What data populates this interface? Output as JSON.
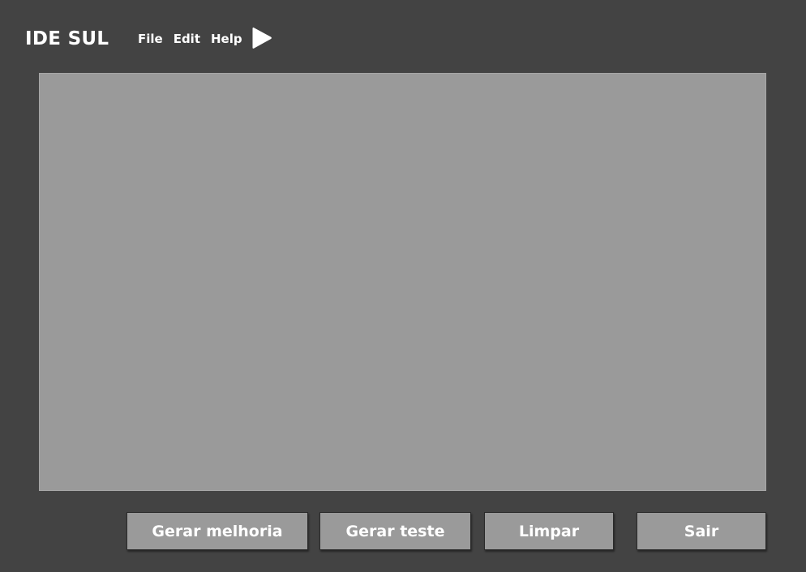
{
  "app": {
    "title": "IDE SUL"
  },
  "menu": {
    "items": [
      {
        "label": "File"
      },
      {
        "label": "Edit"
      },
      {
        "label": "Help"
      }
    ],
    "run_icon": "play-icon"
  },
  "editor": {
    "content": ""
  },
  "actions": {
    "improve_label": "Gerar melhoria",
    "test_label": "Gerar teste",
    "clear_label": "Limpar",
    "exit_label": "Sair"
  },
  "colors": {
    "background": "#434343",
    "panel": "#9a9a9a",
    "text": "#ffffff"
  }
}
